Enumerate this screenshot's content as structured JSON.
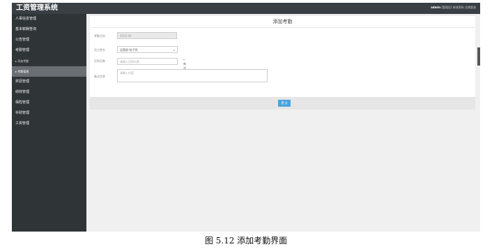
{
  "app": {
    "title": "工资管理系统"
  },
  "topbar": {
    "user": "admin",
    "role": "[管理员]",
    "change_password": "修改密码",
    "logout": "注销登录"
  },
  "sidebar": {
    "items": [
      {
        "label": "人事信息管理"
      },
      {
        "label": "基本薪酬查询"
      },
      {
        "label": "公告管理"
      },
      {
        "label": "考勤管理"
      },
      {
        "label": "▸ 添加考勤"
      },
      {
        "label": "▸ 考勤管理"
      },
      {
        "label": "奖惩管理"
      },
      {
        "label": "绩效管理"
      },
      {
        "label": "保险管理"
      },
      {
        "label": "补助管理"
      },
      {
        "label": "工资管理"
      }
    ]
  },
  "form": {
    "title": "添加考勤",
    "month_label": "考勤月份",
    "month_value": "2022-04",
    "employee_label": "员工姓名",
    "employee_value": "运营部-张子亮",
    "late_days_label": "迟到天数",
    "late_days_placeholder": "请输入迟到天数",
    "late_days_hint": "*每次扣款50",
    "remark_label": "备注信息",
    "remark_placeholder": "请输入内容",
    "submit_label": "提 交"
  },
  "caption": "图 5.12 添加考勤界面"
}
